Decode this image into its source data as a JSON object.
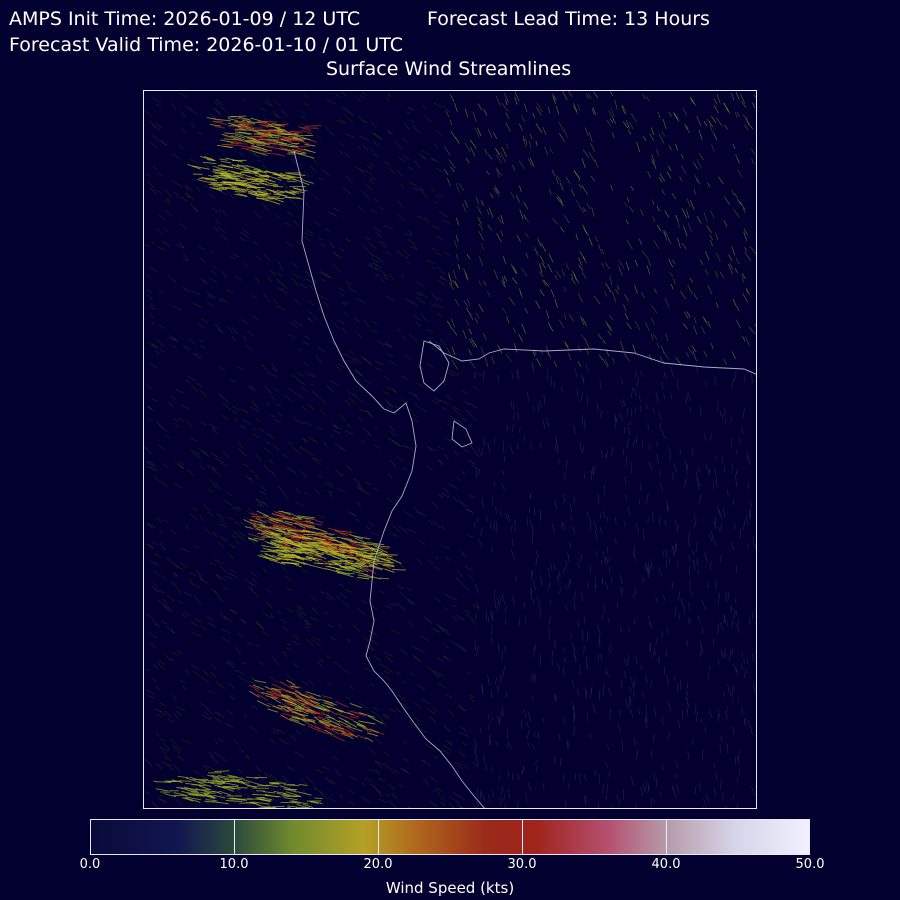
{
  "header": {
    "init_time": "AMPS Init Time: 2026-01-09 / 12 UTC",
    "lead_time": "Forecast Lead Time: 13 Hours",
    "valid_time": "Forecast Valid Time: 2026-01-10 / 01 UTC",
    "title": "Surface Wind Streamlines"
  },
  "colorbar": {
    "label": "Wind Speed (kts)",
    "ticks": [
      "0.0",
      "10.0",
      "20.0",
      "30.0",
      "40.0",
      "50.0"
    ],
    "range": [
      0,
      50
    ]
  },
  "colors": {
    "background": "#02002e",
    "frame": "#e8e8ff",
    "coastline": "#c8c8dc",
    "low_wind": "#2e4e2a",
    "mid_wind": "#9fb42c",
    "high_wind": "#c8c020",
    "strong_wind": "#b8321c"
  }
}
